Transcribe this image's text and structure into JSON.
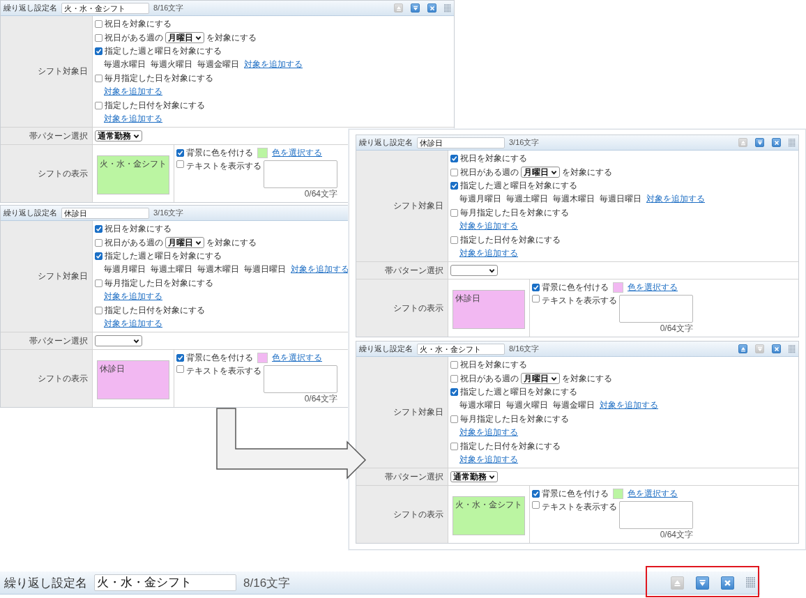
{
  "left_panel": {
    "blocks": [
      {
        "name_label": "繰り返し設定名",
        "name": "火・水・金シフト",
        "count": "8/16文字",
        "buttons": [
          {
            "kind": "up",
            "disabled": true
          },
          {
            "kind": "down",
            "disabled": false
          },
          {
            "kind": "close",
            "disabled": false
          }
        ],
        "target_label": "シフト対象日",
        "options": [
          {
            "kind": "check",
            "label": "祝日を対象にする",
            "checked": false
          },
          {
            "kind": "week_select",
            "prefix": "祝日がある週の",
            "select": "月曜日",
            "suffix": "を対象にする",
            "checked": false
          },
          {
            "kind": "check",
            "label": "指定した週と曜日を対象にする",
            "checked": true
          },
          {
            "kind": "items",
            "items": [
              "毎週水曜日",
              "毎週火曜日",
              "毎週金曜日"
            ],
            "link": "対象を追加する"
          },
          {
            "kind": "check",
            "label": "毎月指定した日を対象にする",
            "checked": false
          },
          {
            "kind": "items",
            "link": "対象を追加する"
          },
          {
            "kind": "check",
            "label": "指定した日付を対象にする",
            "checked": false
          },
          {
            "kind": "items",
            "link": "対象を追加する"
          }
        ],
        "band_label": "帯パターン選択",
        "band_select": "通常勤務",
        "display_label": "シフトの表示",
        "preview": "火・水・金シフト",
        "color": "#bbf5a2",
        "bg_check": {
          "label": "背景に色を付ける",
          "checked": true
        },
        "color_link": "色を選択する",
        "text_check": {
          "label": "テキストを表示する",
          "checked": false
        },
        "text_count": "0/64文字"
      },
      {
        "name_label": "繰り返し設定名",
        "name": "休診日",
        "count": "3/16文字",
        "target_label": "シフト対象日",
        "options": [
          {
            "kind": "check",
            "label": "祝日を対象にする",
            "checked": true
          },
          {
            "kind": "week_select",
            "prefix": "祝日がある週の",
            "select": "月曜日",
            "suffix": "を対象にする",
            "checked": false
          },
          {
            "kind": "check",
            "label": "指定した週と曜日を対象にする",
            "checked": true
          },
          {
            "kind": "items",
            "items": [
              "毎週月曜日",
              "毎週土曜日",
              "毎週木曜日",
              "毎週日曜日"
            ],
            "link": "対象を追加する"
          },
          {
            "kind": "check",
            "label": "毎月指定した日を対象にする",
            "checked": false
          },
          {
            "kind": "items",
            "link": "対象を追加する"
          },
          {
            "kind": "check",
            "label": "指定した日付を対象にする",
            "checked": false
          },
          {
            "kind": "items",
            "link": "対象を追加する"
          }
        ],
        "band_label": "帯パターン選択",
        "display_label": "シフトの表示",
        "preview": "休診日",
        "color": "#f2b8f2",
        "bg_check": {
          "label": "背景に色を付ける",
          "checked": true
        },
        "color_link": "色を選択する",
        "text_check": {
          "label": "テキストを表示する",
          "checked": false
        },
        "text_count": "0/64文字"
      }
    ]
  },
  "right_panel": {
    "blocks": [
      {
        "name_label": "繰り返し設定名",
        "name": "休診日",
        "count": "3/16文字",
        "buttons": [
          {
            "kind": "up",
            "disabled": true
          },
          {
            "kind": "down",
            "disabled": false
          },
          {
            "kind": "close",
            "disabled": false
          }
        ],
        "target_label": "シフト対象日",
        "options": [
          {
            "kind": "check",
            "label": "祝日を対象にする",
            "checked": true
          },
          {
            "kind": "week_select",
            "prefix": "祝日がある週の",
            "select": "月曜日",
            "suffix": "を対象にする",
            "checked": false
          },
          {
            "kind": "check",
            "label": "指定した週と曜日を対象にする",
            "checked": true
          },
          {
            "kind": "items",
            "items": [
              "毎週月曜日",
              "毎週土曜日",
              "毎週木曜日",
              "毎週日曜日"
            ],
            "link": "対象を追加する"
          },
          {
            "kind": "check",
            "label": "毎月指定した日を対象にする",
            "checked": false
          },
          {
            "kind": "items",
            "link": "対象を追加する"
          },
          {
            "kind": "check",
            "label": "指定した日付を対象にする",
            "checked": false
          },
          {
            "kind": "items",
            "link": "対象を追加する"
          }
        ],
        "band_label": "帯パターン選択",
        "display_label": "シフトの表示",
        "preview": "休診日",
        "color": "#f2b8f2",
        "bg_check": {
          "label": "背景に色を付ける",
          "checked": true
        },
        "color_link": "色を選択する",
        "text_check": {
          "label": "テキストを表示する",
          "checked": false
        },
        "text_count": "0/64文字"
      },
      {
        "name_label": "繰り返し設定名",
        "name": "火・水・金シフト",
        "count": "8/16文字",
        "buttons": [
          {
            "kind": "up",
            "disabled": false
          },
          {
            "kind": "down",
            "disabled": true
          },
          {
            "kind": "close",
            "disabled": false
          }
        ],
        "target_label": "シフト対象日",
        "options": [
          {
            "kind": "check",
            "label": "祝日を対象にする",
            "checked": false
          },
          {
            "kind": "week_select",
            "prefix": "祝日がある週の",
            "select": "月曜日",
            "suffix": "を対象にする",
            "checked": false
          },
          {
            "kind": "check",
            "label": "指定した週と曜日を対象にする",
            "checked": true
          },
          {
            "kind": "items",
            "items": [
              "毎週水曜日",
              "毎週火曜日",
              "毎週金曜日"
            ],
            "link": "対象を追加する"
          },
          {
            "kind": "check",
            "label": "毎月指定した日を対象にする",
            "checked": false
          },
          {
            "kind": "items",
            "link": "対象を追加する"
          },
          {
            "kind": "check",
            "label": "指定した日付を対象にする",
            "checked": false
          },
          {
            "kind": "items",
            "link": "対象を追加する"
          }
        ],
        "band_label": "帯パターン選択",
        "band_select": "通常勤務",
        "display_label": "シフトの表示",
        "preview": "火・水・金シフト",
        "color": "#bbf5a2",
        "bg_check": {
          "label": "背景に色を付ける",
          "checked": true
        },
        "color_link": "色を選択する",
        "text_check": {
          "label": "テキストを表示する",
          "checked": false
        },
        "text_count": "0/64文字"
      }
    ]
  },
  "zoomed_header": {
    "name_label": "繰り返し設定名",
    "name": "火・水・金シフト",
    "count": "8/16文字",
    "buttons": [
      {
        "kind": "up",
        "disabled": true
      },
      {
        "kind": "down",
        "disabled": false
      },
      {
        "kind": "close",
        "disabled": false
      }
    ]
  }
}
